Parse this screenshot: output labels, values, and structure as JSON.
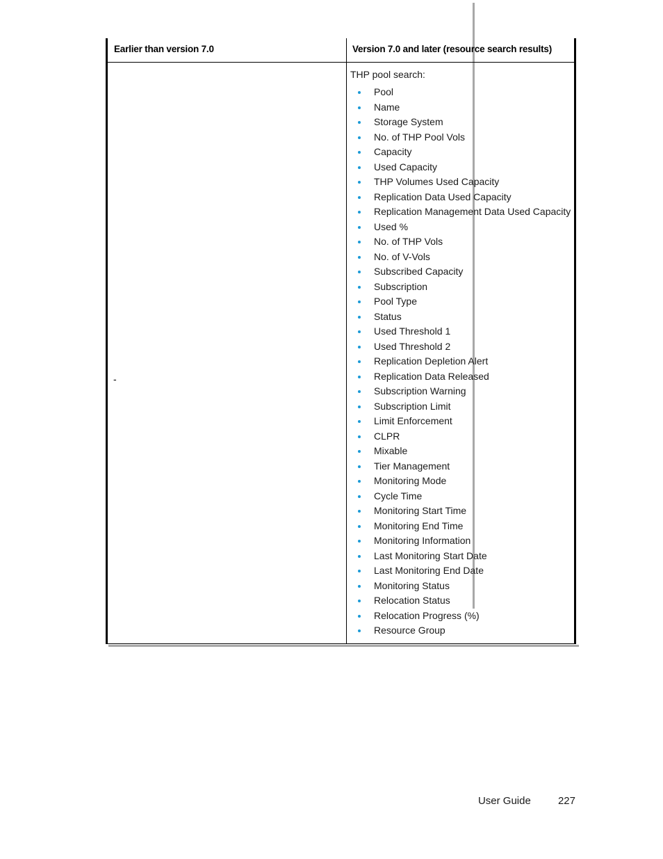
{
  "page": {
    "footer_label": "User Guide",
    "page_number": "227",
    "bullet_color": "#1b9ad6"
  },
  "table": {
    "headers": {
      "left": "Earlier than version 7.0",
      "right": "Version 7.0 and later (resource search results)"
    },
    "left_cell": {
      "marker": "-"
    },
    "right_cell": {
      "intro": "THP pool search:",
      "items": [
        "Pool",
        "Name",
        "Storage System",
        "No. of THP Pool Vols",
        "Capacity",
        "Used Capacity",
        "THP Volumes Used Capacity",
        "Replication Data Used Capacity",
        "Replication Management Data Used Capacity",
        "Used %",
        "No. of THP Vols",
        "No. of V-Vols",
        "Subscribed Capacity",
        "Subscription",
        "Pool Type",
        "Status",
        "Used Threshold 1",
        "Used Threshold 2",
        "Replication Depletion Alert",
        "Replication Data Released",
        "Subscription Warning",
        "Subscription Limit",
        "Limit Enforcement",
        "CLPR",
        "Mixable",
        "Tier Management",
        "Monitoring Mode",
        "Cycle Time",
        "Monitoring Start Time",
        "Monitoring End Time",
        "Monitoring Information",
        "Last Monitoring Start Date",
        "Last Monitoring End Date",
        "Monitoring Status",
        "Relocation Status",
        "Relocation Progress (%)",
        "Resource Group"
      ]
    }
  }
}
